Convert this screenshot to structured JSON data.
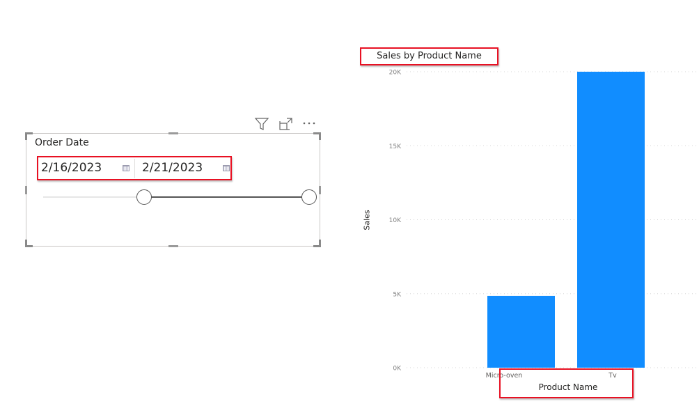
{
  "slicer": {
    "title": "Order Date",
    "start_date": "2/16/2023",
    "end_date": "2/21/2023",
    "range_start_fraction": 0.38,
    "range_end_fraction": 1.0,
    "header_icons": [
      "filter-icon",
      "focus-mode-icon",
      "more-options-icon"
    ]
  },
  "chart_data": {
    "type": "bar",
    "title": "Sales by Product Name",
    "xlabel": "Product Name",
    "ylabel": "Sales",
    "categories": [
      "Micro-oven",
      "Tv"
    ],
    "values": [
      4850,
      20000
    ],
    "ylim": [
      0,
      20000
    ],
    "yticks": [
      0,
      5000,
      10000,
      15000,
      20000
    ],
    "ytick_labels": [
      "0K",
      "5K",
      "10K",
      "15K",
      "20K"
    ],
    "grid": true,
    "bar_color": "#118DFF",
    "legend": "none"
  },
  "annotations": {
    "highlight_color": "#E81123"
  }
}
